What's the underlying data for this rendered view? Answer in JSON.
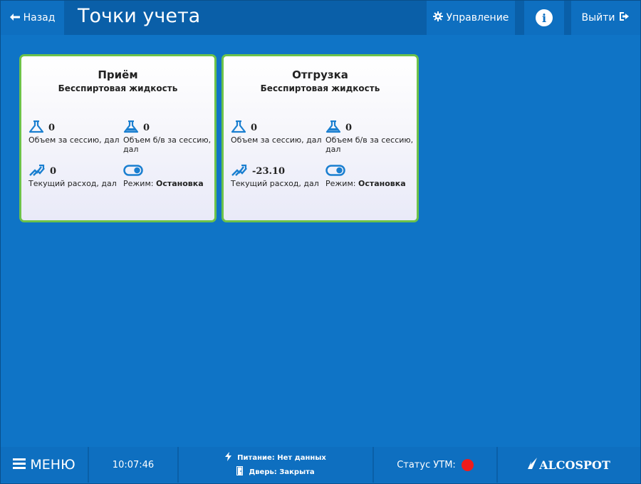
{
  "header": {
    "back_label": "Назад",
    "title": "Точки учета",
    "manage_label": "Управление",
    "exit_label": "Выйти"
  },
  "cards": [
    {
      "title": "Приём",
      "subtitle": "Бесспиртовая жидкость",
      "volume_session_value": "0",
      "volume_session_label": "Объем за сессию, дал",
      "volume_bv_value": "0",
      "volume_bv_label": "Объем б/в за сессию, дал",
      "flow_value": "0",
      "flow_label": "Текущий расход, дал",
      "mode_label": "Режим:",
      "mode_value": "Остановка"
    },
    {
      "title": "Отгрузка",
      "subtitle": "Бесспиртовая жидкость",
      "volume_session_value": "0",
      "volume_session_label": "Объем за сессию, дал",
      "volume_bv_value": "0",
      "volume_bv_label": "Объем б/в за сессию, дал",
      "flow_value": "-23.10",
      "flow_label": "Текущий расход, дал",
      "mode_label": "Режим:",
      "mode_value": "Остановка"
    }
  ],
  "footer": {
    "menu_label": "МЕНЮ",
    "time": "10:07:46",
    "power_label": "Питание: Нет данных",
    "door_label": "Дверь: Закрыта",
    "utm_label": "Статус УТМ:",
    "logo_text": "ALCOSPOT"
  },
  "colors": {
    "background": "#0f74c6",
    "header": "#0e6fc0",
    "card_border": "#6cc24a",
    "icon_blue": "#1a7fd0",
    "utm_status": "#ee1c1c"
  }
}
